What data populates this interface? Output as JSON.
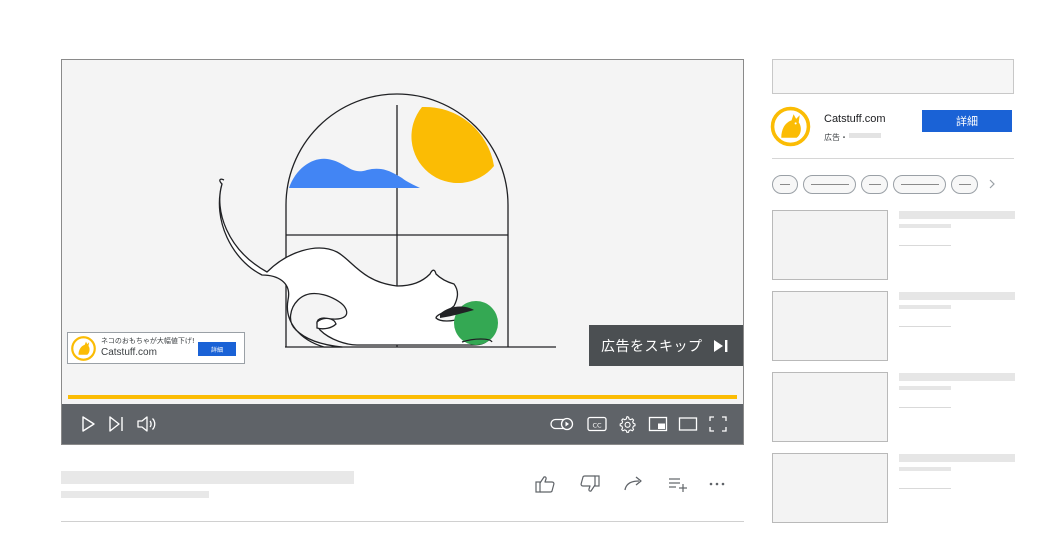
{
  "player": {
    "progress_fraction": 1.0,
    "skip_label": "広告をスキップ"
  },
  "overlay_ad": {
    "headline": "ネコのおもちゃが大幅値下げ!",
    "domain": "Catstuff.com",
    "cta_label": "詳細"
  },
  "companion_ad": {
    "domain": "Catstuff.com",
    "label": "広告・",
    "cta_label": "詳細"
  },
  "colors": {
    "accent_blue": "#1a62d6",
    "brand_yellow": "#fbbc04",
    "controls_bg": "#5f6368",
    "ball_green": "#34a853",
    "cloud_blue": "#4285f4"
  },
  "icons": {
    "controls_left": [
      "play-icon",
      "next-icon",
      "volume-icon"
    ],
    "controls_right": [
      "autoplay-toggle-icon",
      "captions-icon",
      "settings-icon",
      "miniplayer-icon",
      "theater-mode-icon",
      "fullscreen-icon"
    ],
    "actions": [
      "like-icon",
      "dislike-icon",
      "share-icon",
      "save-playlist-icon",
      "more-icon"
    ],
    "chips_next": "chevron-right-icon"
  }
}
